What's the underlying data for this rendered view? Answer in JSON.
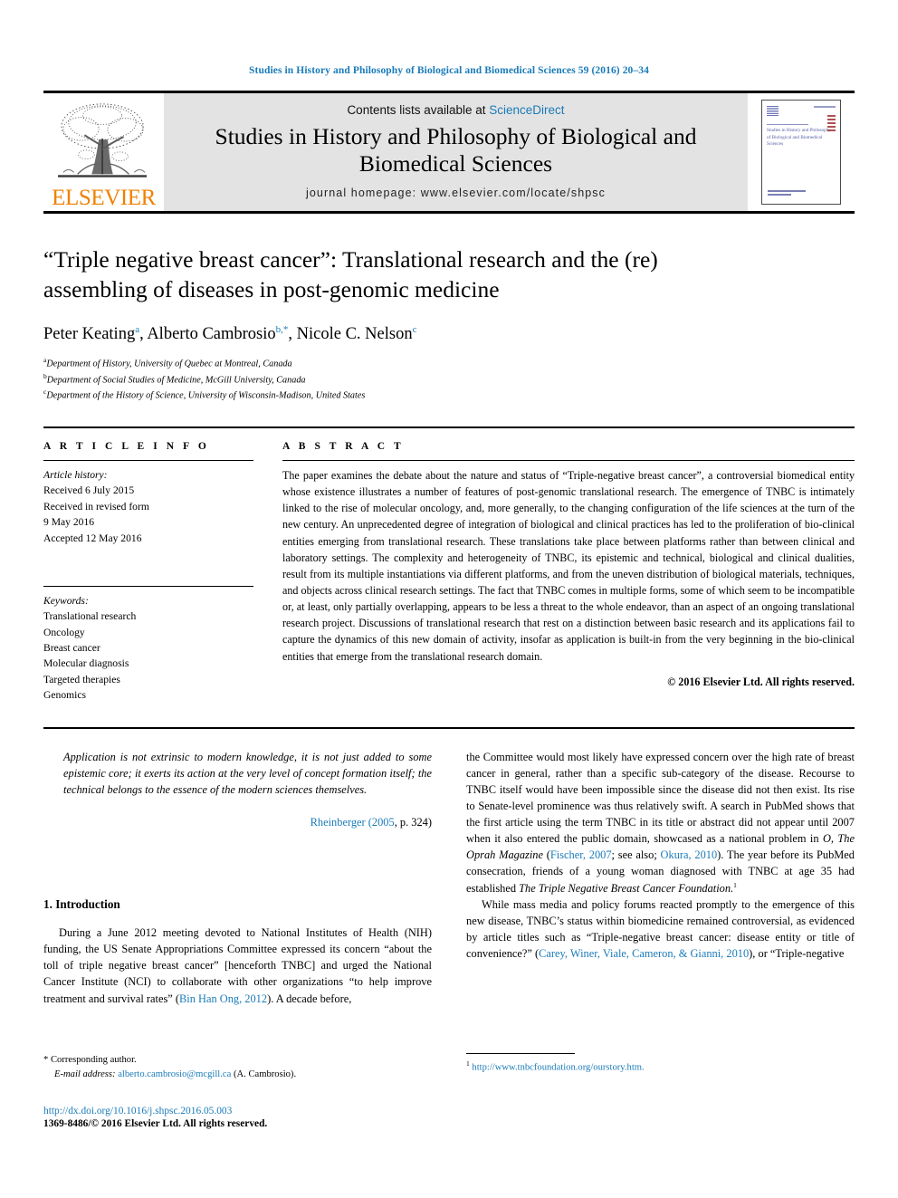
{
  "running_head": "Studies in History and Philosophy of Biological and Biomedical Sciences 59 (2016) 20–34",
  "masthead": {
    "publisher_wordmark": "ELSEVIER",
    "contents_prefix": "Contents lists available at ",
    "contents_link": "ScienceDirect",
    "journal_title": "Studies in History and Philosophy of Biological and Biomedical Sciences",
    "homepage": "journal homepage: www.elsevier.com/locate/shpsc",
    "cover_title": "Studies in History and Philosophy of Biological and Biomedical Sciences"
  },
  "article": {
    "title": "“Triple negative breast cancer”: Translational research and the (re) assembling of diseases in post-genomic medicine",
    "authors_html": "Peter Keating<sup>a</sup>, Alberto Cambrosio<sup>b,*</sup>, Nicole C. Nelson<sup>c</sup>",
    "affiliations": [
      {
        "marker": "a",
        "text": "Department of History, University of Quebec at Montreal, Canada"
      },
      {
        "marker": "b",
        "text": "Department of Social Studies of Medicine, McGill University, Canada"
      },
      {
        "marker": "c",
        "text": "Department of the History of Science, University of Wisconsin-Madison, United States"
      }
    ]
  },
  "article_info": {
    "heading": "A R T I C L E  I N F O",
    "history_label": "Article history:",
    "history_lines": [
      "Received 6 July 2015",
      "Received in revised form",
      "9 May 2016",
      "Accepted 12 May 2016"
    ],
    "keywords_label": "Keywords:",
    "keywords": [
      "Translational research",
      "Oncology",
      "Breast cancer",
      "Molecular diagnosis",
      "Targeted therapies",
      "Genomics"
    ]
  },
  "abstract": {
    "heading": "A B S T R A C T",
    "body": "The paper examines the debate about the nature and status of “Triple-negative breast cancer”, a controversial biomedical entity whose existence illustrates a number of features of post-genomic translational research. The emergence of TNBC is intimately linked to the rise of molecular oncology, and, more generally, to the changing configuration of the life sciences at the turn of the new century. An unprecedented degree of integration of biological and clinical practices has led to the proliferation of bio-clinical entities emerging from translational research. These translations take place between platforms rather than between clinical and laboratory settings. The complexity and heterogeneity of TNBC, its epistemic and technical, biological and clinical dualities, result from its multiple instantiations via different platforms, and from the uneven distribution of biological materials, techniques, and objects across clinical research settings. The fact that TNBC comes in multiple forms, some of which seem to be incompatible or, at least, only partially overlapping, appears to be less a threat to the whole endeavor, than an aspect of an ongoing translational research project. Discussions of translational research that rest on a distinction between basic research and its applications fail to capture the dynamics of this new domain of activity, insofar as application is built-in from the very beginning in the bio-clinical entities that emerge from the translational research domain.",
    "copyright": "© 2016 Elsevier Ltd. All rights reserved."
  },
  "epigraph": {
    "quote": "Application is not extrinsic to modern knowledge, it is not just added to some epistemic core; it exerts its action at the very level of concept formation itself; the technical belongs to the essence of the modern sciences themselves.",
    "citation_link": "Rheinberger (2005",
    "citation_rest": ", p. 324)"
  },
  "section": {
    "heading": "1. Introduction",
    "paragraph1_a": "During a June 2012 meeting devoted to National Institutes of Health (NIH) funding, the US Senate Appropriations Committee expressed its concern “about the toll of triple negative breast cancer” [henceforth TNBC] and urged the National Cancer Institute (NCI) to collaborate with other organizations “to help improve treatment and survival rates” (",
    "paragraph1_cite": "Bin Han Ong, 2012",
    "paragraph1_b": "). A decade before,"
  },
  "right_column": {
    "para1_a": "the Committee would most likely have expressed concern over the high rate of breast cancer in general, rather than a specific sub-category of the disease. Recourse to TNBC itself would have been impossible since the disease did not then exist. Its rise to Senate-level prominence was thus relatively swift. A search in PubMed shows that the first article using the term TNBC in its title or abstract did not appear until 2007 when it also entered the public domain, showcased as a national problem in ",
    "para1_italic1": "O, The Oprah Magazine",
    "para1_b": " (",
    "para1_cite1": "Fischer, 2007",
    "para1_c": "; see also; ",
    "para1_cite2": "Okura, 2010",
    "para1_d": "). The year before its PubMed consecration, friends of a young woman diagnosed with TNBC at age 35 had established ",
    "para1_italic2": "The Triple Negative Breast Cancer Foundation.",
    "para1_footnote": "1",
    "para2_a": "While mass media and policy forums reacted promptly to the emergence of this new disease, TNBC’s status within biomedicine remained controversial, as evidenced by article titles such as “Triple-negative breast cancer: disease entity or title of convenience?” (",
    "para2_cite": "Carey, Winer, Viale, Cameron, & Gianni, 2010",
    "para2_b": "), or “Triple-negative"
  },
  "footnotes": {
    "corresponding_marker": "*",
    "corresponding_label": "Corresponding author.",
    "email_label": "E-mail address:",
    "email": "alberto.cambrosio@mcgill.ca",
    "email_suffix": "(A. Cambrosio).",
    "doi": "http://dx.doi.org/10.1016/j.shpsc.2016.05.003",
    "issn_line": "1369-8486/© 2016 Elsevier Ltd. All rights reserved.",
    "note1_marker": "1",
    "note1_url": "http://www.tnbcfoundation.org/ourstory.htm."
  },
  "colors": {
    "link": "#1a7bb9",
    "elsevier_orange": "#f08000",
    "masthead_gray": "#e3e3e3"
  }
}
